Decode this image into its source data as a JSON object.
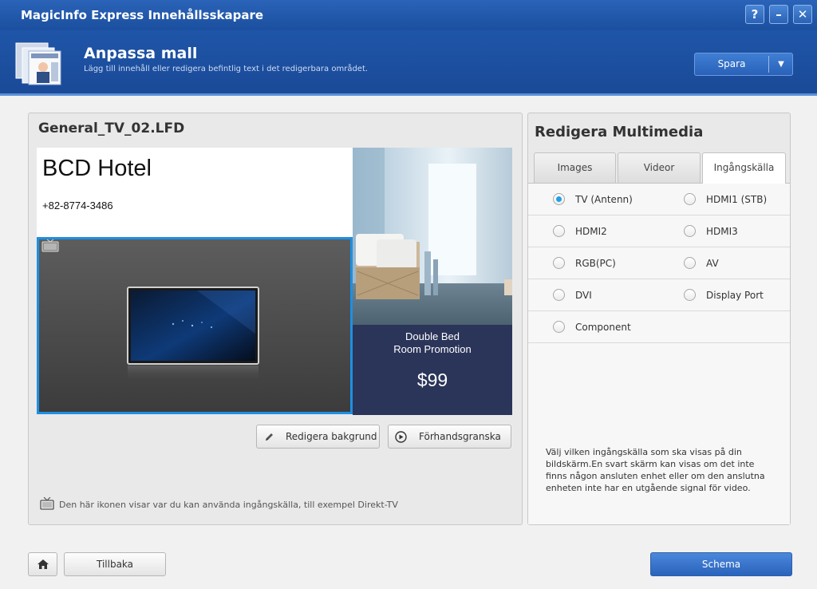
{
  "window": {
    "title": "MagicInfo Express Innehållsskapare",
    "help_label": "?",
    "minimize_label": "–",
    "close_label": "✕"
  },
  "header": {
    "title": "Anpassa mall",
    "subtitle": "Lägg till innehåll eller redigera befintlig text i det redigerbara området.",
    "save_label": "Spara",
    "save_dropdown_icon": "chevron-down-icon"
  },
  "template_panel": {
    "file_name": "General_TV_02.LFD",
    "hotel_name": "BCD Hotel",
    "phone": "+82-8774-3486",
    "promo_line1": "Double Bed",
    "promo_line2": "Room Promotion",
    "price": "$99",
    "edit_background_label": "Redigera bakgrund",
    "preview_label": "Förhandsgranska",
    "hint": "Den här ikonen visar var du kan använda ingångskälla, till exempel Direkt-TV"
  },
  "multimedia_panel": {
    "title": "Redigera Multimedia",
    "tabs": [
      {
        "label": "Images"
      },
      {
        "label": "Videor"
      },
      {
        "label": "Ingångskälla"
      }
    ],
    "active_tab": "Ingångskälla",
    "sources": [
      {
        "label": "TV (Antenn)",
        "selected": true
      },
      {
        "label": "HDMI1 (STB)",
        "selected": false
      },
      {
        "label": "HDMI2",
        "selected": false
      },
      {
        "label": "HDMI3",
        "selected": false
      },
      {
        "label": "RGB(PC)",
        "selected": false
      },
      {
        "label": "AV",
        "selected": false
      },
      {
        "label": "DVI",
        "selected": false
      },
      {
        "label": "Display Port",
        "selected": false
      },
      {
        "label": "Component",
        "selected": false
      }
    ],
    "description": "Välj vilken ingångskälla som ska visas på din bildskärm.En svart skärm kan visas om det inte finns någon ansluten enhet eller om den anslutna enheten inte har en utgående signal för video."
  },
  "footer": {
    "back_label": "Tillbaka",
    "schedule_label": "Schema"
  },
  "colors": {
    "title_bar": "#2a63b8",
    "accent": "#1e8fe3",
    "promo_bg": "#2b3459"
  }
}
